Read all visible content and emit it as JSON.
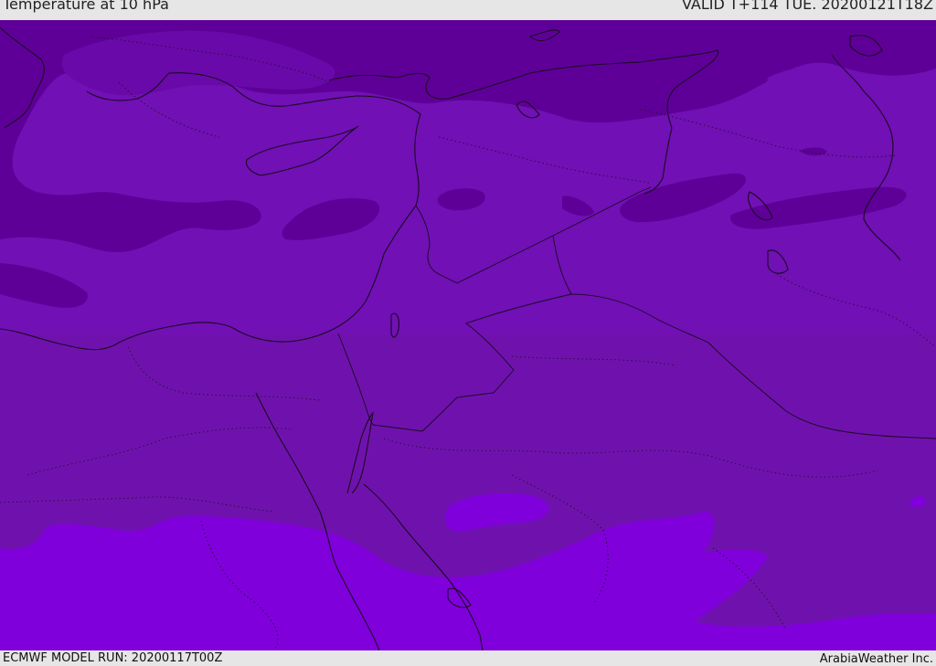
{
  "header": {
    "title": "Temperature at 10 hPa",
    "valid": "VALID T+114 TUE. 20200121T18Z"
  },
  "footer": {
    "model_run": "ECMWF MODEL RUN: 20200117T00Z",
    "credit": "ArabiaWeather Inc."
  },
  "colors": {
    "band_dark": "#5e0098",
    "band_mid_dark": "#6a09a9",
    "band_mid": "#7110b5",
    "band_south": "#6f12ad",
    "band_light": "#8000dc",
    "border": "#1a0a20",
    "bar_bg": "#e6e6e6"
  }
}
